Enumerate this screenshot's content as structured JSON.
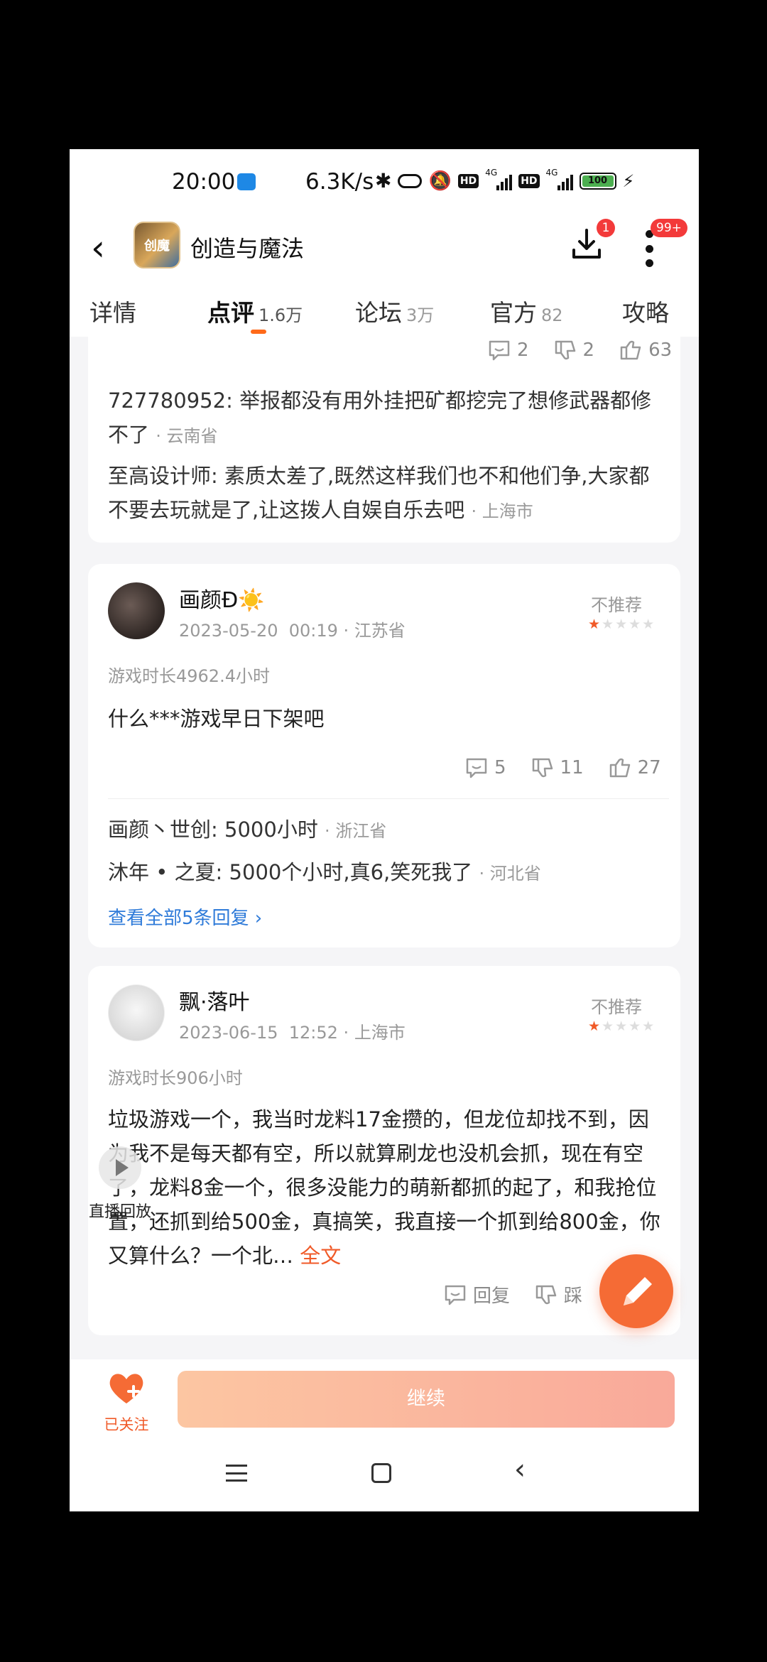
{
  "status_bar": {
    "time": "20:00",
    "net_speed": "6.3K/s",
    "hd": "HD",
    "net_4g": "4G",
    "battery": "100"
  },
  "header": {
    "app_title": "创造与魔法",
    "app_icon_text": "创魔",
    "download_badge": "1",
    "more_badge": "99+"
  },
  "tabs": [
    {
      "label": "详情",
      "count": ""
    },
    {
      "label": "点评",
      "count": "1.6万"
    },
    {
      "label": "论坛",
      "count": "3万"
    },
    {
      "label": "官方",
      "count": "82"
    },
    {
      "label": "攻略",
      "count": ""
    }
  ],
  "top_card": {
    "comment_count": "2",
    "dislike_count": "2",
    "like_count": "63",
    "replies": [
      {
        "name": "727780952",
        "text": "举报都没有用外挂把矿都挖完了想修武器都修不了",
        "location": "云南省"
      },
      {
        "name": "至高设计师",
        "text": "素质太差了,既然这样我们也不和他们争,大家都不要去玩就是了,让这拨人自娱自乐去吧",
        "location": "上海市"
      }
    ]
  },
  "review1": {
    "username": "画颜Ð☀️",
    "date": "2023-05-20",
    "time": "00:19",
    "location": "江苏省",
    "recommendation": "不推荐",
    "rating": 1,
    "playtime": "游戏时长4962.4小时",
    "text": "什么***游戏早日下架吧",
    "comment_count": "5",
    "dislike_count": "11",
    "like_count": "27",
    "replies": [
      {
        "name": "画颜丶世创",
        "text": "5000小时",
        "location": "浙江省"
      },
      {
        "name": "沐年 • 之夏",
        "text": "5000个小时,真6,笑死我了",
        "location": "河北省"
      }
    ],
    "view_all": "查看全部5条回复 ›"
  },
  "review2": {
    "username": "飘·落叶",
    "date": "2023-06-15",
    "time": "12:52",
    "location": "上海市",
    "recommendation": "不推荐",
    "rating": 1,
    "playtime": "游戏时长906小时",
    "text": "垃圾游戏一个，我当时龙料17金攒的，但龙位却找不到，因为我不是每天都有空，所以就算刷龙也没机会抓，现在有空了，龙料8金一个，很多没能力的萌新都抓的起了，和我抢位置，还抓到给500金，真搞笑，我直接一个抓到给800金，你又算什么？一个北…",
    "more": "全文",
    "reply_label": "回复",
    "dislike_label": "踩"
  },
  "floating": {
    "live_replay": "直播回放"
  },
  "bottom_bar": {
    "follow_label": "已关注",
    "continue_label": "继续"
  },
  "colors": {
    "accent": "#f05a28",
    "link": "#2f7bd9",
    "badge": "#f33a3a"
  }
}
